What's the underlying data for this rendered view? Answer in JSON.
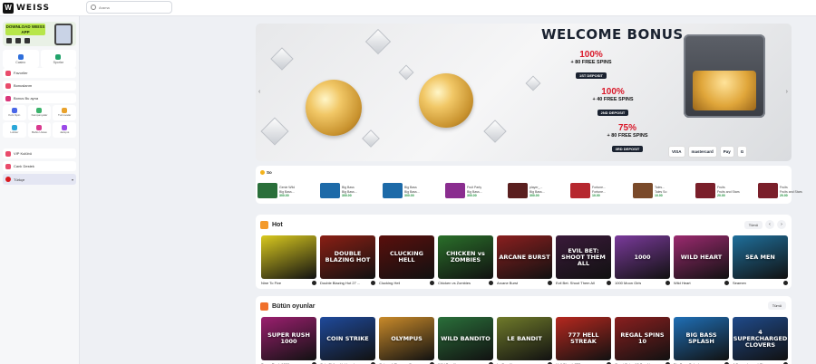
{
  "brand": {
    "name": "WEISS"
  },
  "search": {
    "placeholder": "Arama"
  },
  "sidebar": {
    "app_banner": {
      "title": "DOWNLOAD WEISS APP"
    },
    "quick": [
      {
        "label": "Casino",
        "color": "#2f6fdb"
      },
      {
        "label": "Sporlar",
        "color": "#22a36b"
      }
    ],
    "items": [
      {
        "label": "Favoriler",
        "color": "#e94b6b"
      },
      {
        "label": "Bonuslarım",
        "color": "#e94b6b"
      },
      {
        "label": "Bonus Bu ayna",
        "color": "#d9367a"
      }
    ],
    "grid": [
      {
        "label": "Kolo Spin",
        "color": "#4a67e8"
      },
      {
        "label": "Kampanyalar",
        "color": "#3bb36c"
      },
      {
        "label": "Turnuvalar",
        "color": "#e9a22b"
      },
      {
        "label": "Lobiler",
        "color": "#2ba7d9"
      },
      {
        "label": "Bahis Ustası",
        "color": "#d93a8f"
      },
      {
        "label": "Jackpot",
        "color": "#9b4ae8"
      }
    ],
    "items2": [
      {
        "label": "VIP Kulübü",
        "color": "#e94b6b"
      },
      {
        "label": "Canlı Destek",
        "color": "#e94b6b"
      }
    ],
    "language": {
      "label": "Türkçe",
      "color": "#d9191f"
    }
  },
  "hero": {
    "title": "WELCOME BONUS",
    "offers": [
      {
        "pct": "100%",
        "spins": "+ 80 FREE SPINS",
        "deposit": "1ST DEPOSIT"
      },
      {
        "pct": "100%",
        "spins": "+ 40 FREE SPINS",
        "deposit": "2ND DEPOSIT"
      },
      {
        "pct": "75%",
        "spins": "+ 80 FREE SPINS",
        "deposit": "3RD DEPOSIT"
      }
    ],
    "payments": [
      "VISA",
      "mastercard",
      "Pay",
      "G"
    ]
  },
  "wins": {
    "title": "So",
    "cards": [
      {
        "game": "Genie Wild",
        "player": "Big Bass...",
        "amount": "300.00",
        "color": "#2a6f3a"
      },
      {
        "game": "Big Bass",
        "player": "Big Bass...",
        "amount": "300.00",
        "color": "#1d6aa8"
      },
      {
        "game": "Big Bass",
        "player": "Big Bass...",
        "amount": "300.00",
        "color": "#1d6aa8"
      },
      {
        "game": "Fruit Party",
        "player": "Big Bass...",
        "amount": "300.00",
        "color": "#8a2d8f"
      },
      {
        "game": "player_...",
        "player": "Big Bass...",
        "amount": "300.00",
        "color": "#5a1f1f"
      },
      {
        "game": "Fortune...",
        "player": "Fortune...",
        "amount": "10.00",
        "color": "#b6282f"
      },
      {
        "game": "Tales...",
        "player": "Tales So",
        "amount": "10.00",
        "color": "#7a4a2a"
      },
      {
        "game": "Fruits",
        "player": "Fruits and Stars",
        "amount": "20.00",
        "color": "#7a1f2a"
      },
      {
        "game": "Fruits",
        "player": "Fruits and Stars",
        "amount": "20.00",
        "color": "#7a1f2a"
      }
    ]
  },
  "hot": {
    "title": "Hot",
    "all_label": "Tümü",
    "games": [
      {
        "name": "Nine To Five",
        "tile": "",
        "color": "#d9c91f"
      },
      {
        "name": "Double Blazing Hot 27 ...",
        "tile": "DOUBLE BLAZING HOT",
        "color": "#8a1f14"
      },
      {
        "name": "Clucking Hell",
        "tile": "CLUCKING HELL",
        "color": "#5a0f0c"
      },
      {
        "name": "Chicken vs Zombies",
        "tile": "CHICKEN vs ZOMBIES",
        "color": "#2a6f2a"
      },
      {
        "name": "Arcane Burst",
        "tile": "ARCANE BURST",
        "color": "#8a1f1f"
      },
      {
        "name": "Evil Bet. Shoot Them All",
        "tile": "EVIL BET: SHOOT THEM ALL",
        "color": "#3a1a3a"
      },
      {
        "name": "1000 Moon Girls",
        "tile": "1000",
        "color": "#7a3a9b"
      },
      {
        "name": "Wild Heart",
        "tile": "WILD HEART",
        "color": "#9b2a6f"
      },
      {
        "name": "Seamen",
        "tile": "SEA MEN",
        "color": "#1f6f9b"
      }
    ]
  },
  "all_games": {
    "title": "Bütün oyunlar",
    "all_label": "Tümü",
    "games": [
      {
        "name": "Super Rush 1000",
        "tile": "SUPER RUSH 1000",
        "color": "#9b1f6f"
      },
      {
        "name": "Coin Strike: Hold and ...",
        "tile": "COIN STRIKE",
        "color": "#1f4a9b"
      },
      {
        "name": "Gates of Olympus Sup...",
        "tile": "OLYMPUS",
        "color": "#c98a2a"
      },
      {
        "name": "Wild Bandito",
        "tile": "WILD BANDITO",
        "color": "#2a6f3a"
      },
      {
        "name": "Le Bandit",
        "tile": "LE BANDIT",
        "color": "#6f7a2a"
      },
      {
        "name": "Hell Streak 777",
        "tile": "777 HELL STREAK",
        "color": "#b6281f"
      },
      {
        "name": "Great Spins 10 Sun Lin...",
        "tile": "REGAL SPINS 10",
        "color": "#8a1f1f"
      },
      {
        "name": "Big Bass Splash",
        "tile": "BIG BASS SPLASH",
        "color": "#1f6fb6"
      },
      {
        "name": "4 Supercharged Clover...",
        "tile": "4 SUPERCHARGED CLOVERS",
        "color": "#1f4a8a"
      }
    ]
  }
}
